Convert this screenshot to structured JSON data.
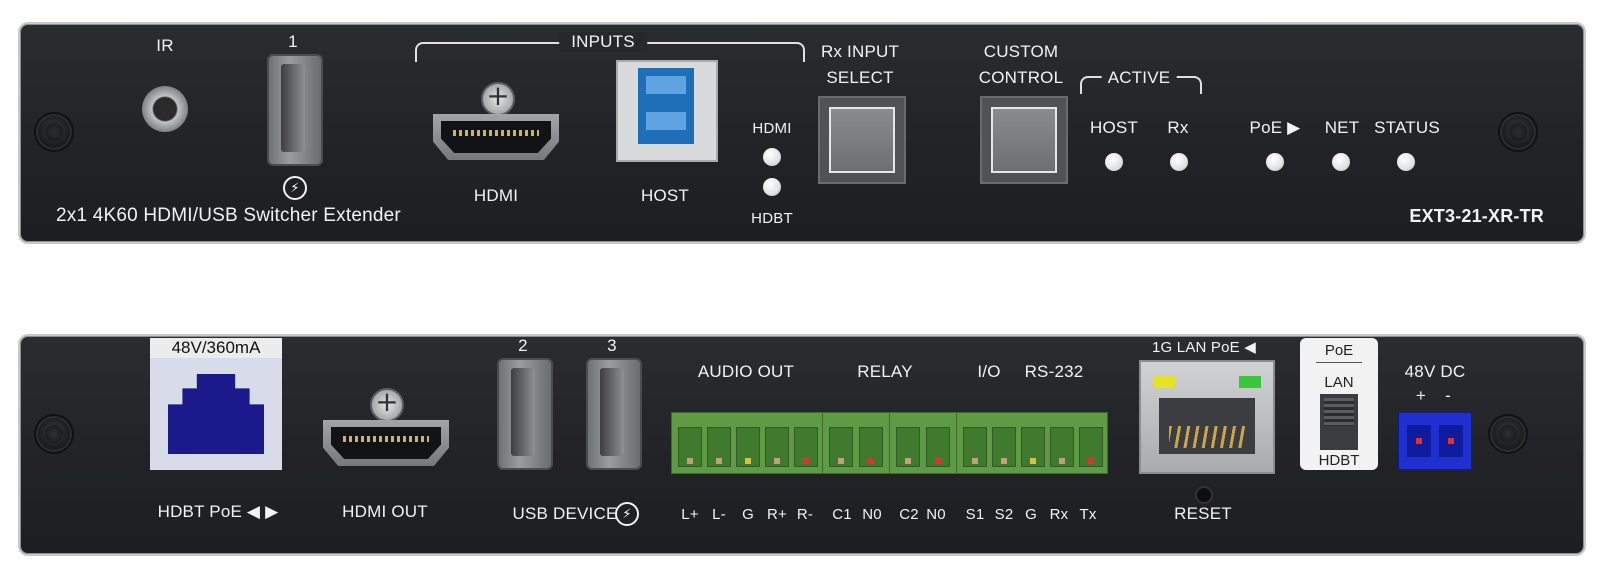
{
  "front": {
    "ir_label": "IR",
    "usb_port_number": "1",
    "usb_power_icon": "power-bolt-icon",
    "inputs_label": "INPUTS",
    "hdmi_label": "HDMI",
    "host_label": "HOST",
    "led_hdmi_label": "HDMI",
    "led_hdbt_label": "HDBT",
    "rx_input_select_label_line1": "Rx INPUT",
    "rx_input_select_label_line2": "SELECT",
    "custom_control_label_line1": "CUSTOM",
    "custom_control_label_line2": "CONTROL",
    "active_label": "ACTIVE",
    "active_host_label": "HOST",
    "active_rx_label": "Rx",
    "poe_label": "PoE ▶",
    "net_label": "NET",
    "status_label": "STATUS",
    "product_description": "2x1 4K60 HDMI/USB Switcher Extender",
    "model_name": "EXT3-21-XR-TR"
  },
  "rear": {
    "hdbt_power_label": "48V/360mA",
    "hdbt_poe_label": "HDBT PoE ◀ ▶",
    "hdmi_out_label": "HDMI OUT",
    "usb_port_2": "2",
    "usb_port_3": "3",
    "usb_device_label": "USB DEVICE",
    "audio_out_label": "AUDIO OUT",
    "relay_label": "RELAY",
    "io_label": "I/O",
    "rs232_label": "RS-232",
    "audio_pins": [
      "L+",
      "L-",
      "G",
      "R+",
      "R-"
    ],
    "relay_pins": [
      "C1",
      "N0",
      "C2",
      "N0"
    ],
    "io_rs232_pins": [
      "S1",
      "S2",
      "G",
      "Rx",
      "Tx"
    ],
    "lan_label": "1G LAN PoE ◀",
    "reset_label": "RESET",
    "switch_top_label": "PoE",
    "switch_mid_label": "LAN",
    "switch_bottom_label": "HDBT",
    "dc_label": "48V DC",
    "dc_plus": "+",
    "dc_minus": "-"
  },
  "colors": {
    "panel": "#242528",
    "terminal_green": "#5f9a45",
    "usb3_blue": "#1f6fb8",
    "hdbt_blue": "#1a1a8c",
    "dc_blue": "#1f2fd0",
    "led_yellow": "#e6e22a",
    "led_green": "#38c93a"
  }
}
